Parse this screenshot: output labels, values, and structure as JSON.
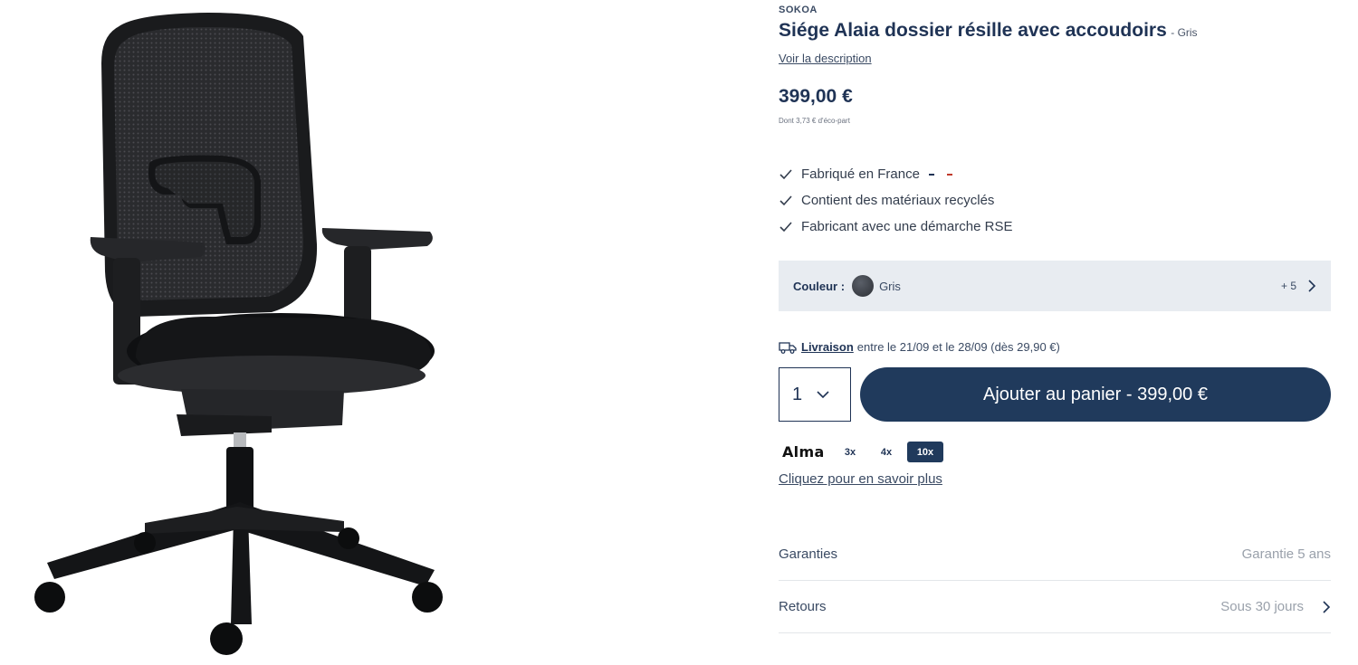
{
  "product": {
    "brand": "SOKOA",
    "title": "Siége Alaia dossier résille avec accoudoirs",
    "variant": "- Gris",
    "description_link": "Voir la description",
    "price": "399,00 €",
    "eco_part": "Dont 3,73 € d'éco-part",
    "image_icon": "office-chair-image"
  },
  "features": [
    {
      "label": "Fabriqué en France",
      "icon": "check-icon"
    },
    {
      "label": "Contient des matériaux recyclés",
      "icon": "check-icon"
    },
    {
      "label": "Fabricant avec une démarche RSE",
      "icon": "check-icon"
    }
  ],
  "flag_colors": [
    "#1f3355",
    "#ffffff",
    "#c0392b"
  ],
  "color_selector": {
    "label": "Couleur :",
    "value": "Gris",
    "swatch_color": "#3c4048",
    "more": "+ 5"
  },
  "delivery": {
    "link": "Livraison",
    "text": "entre le 21/09 et le 28/09 (dès 29,90 €)"
  },
  "quantity": {
    "value": "1"
  },
  "add_to_cart": {
    "label": "Ajouter au panier - 399,00 €"
  },
  "alma": {
    "logo": "Alma",
    "options": [
      "3x",
      "4x",
      "10x"
    ],
    "active": "10x",
    "link": "Cliquez pour en savoir plus"
  },
  "info_rows": [
    {
      "label": "Garanties",
      "value": "Garantie 5 ans"
    },
    {
      "label": "Retours",
      "value": "Sous 30 jours"
    }
  ],
  "colors": {
    "primary": "#203a5c",
    "box_bg": "#e8ecf1",
    "muted": "#9aa1ab"
  }
}
